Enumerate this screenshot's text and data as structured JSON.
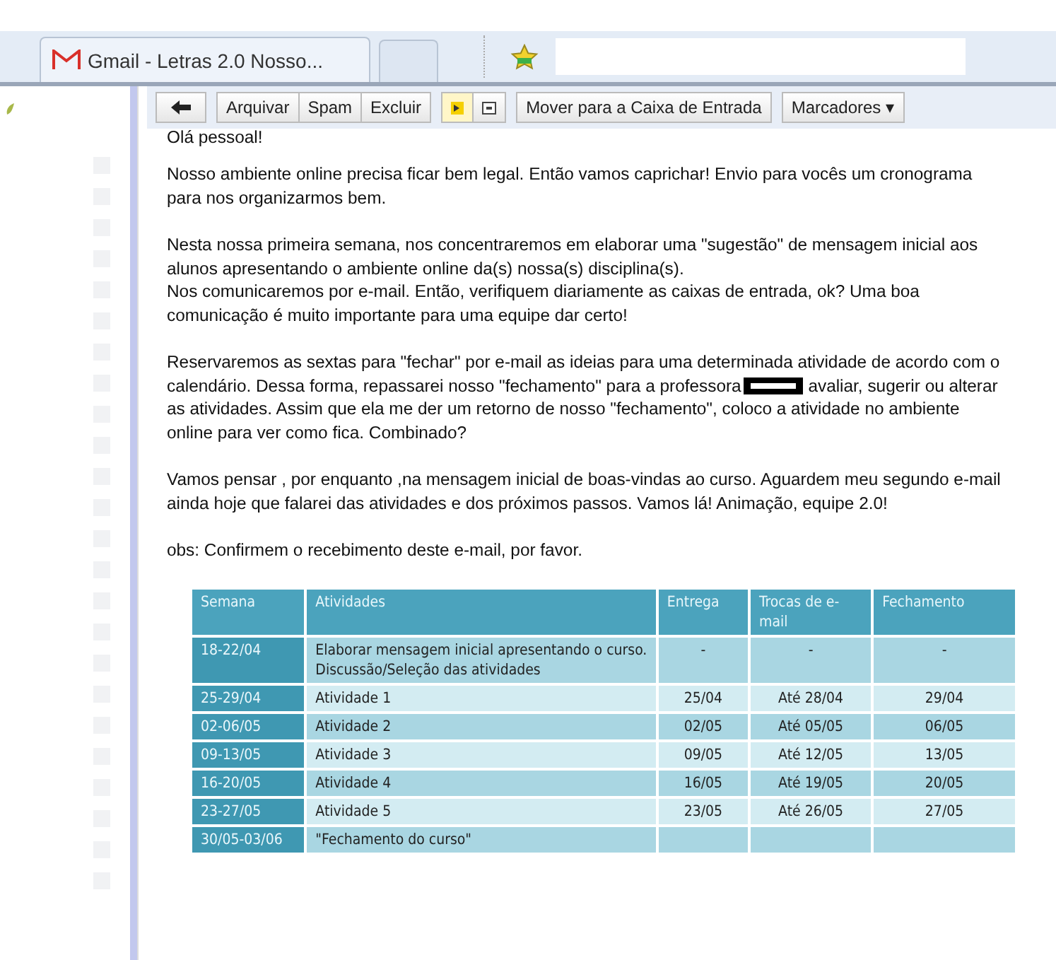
{
  "browser": {
    "tabs": [
      {
        "kind": "page",
        "title": "Gmail - Letras 2.0 Nosso...",
        "selected": true
      },
      {
        "kind": "new",
        "selected": false
      }
    ]
  },
  "toolbar": {
    "groups": [
      [
        {
          "kind": "back"
        }
      ],
      [
        {
          "kind": "text",
          "label": "Arquivar"
        },
        {
          "kind": "text",
          "label": "Spam"
        },
        {
          "kind": "text",
          "label": "Excluir"
        }
      ],
      [
        {
          "kind": "important"
        },
        {
          "kind": "square"
        }
      ],
      [
        {
          "kind": "text",
          "label": "Mover para a Caixa de Entrada"
        }
      ],
      [
        {
          "kind": "menu",
          "label": "Marcadores",
          "caret": "▾"
        }
      ]
    ]
  },
  "message": {
    "greeting": "Olá pessoal!",
    "paragraphs": [
      [
        {
          "kind": "text",
          "text": "Nosso ambiente online precisa ficar bem legal. Então vamos caprichar! Envio para vocês um cronograma para nos organizarmos bem."
        }
      ],
      [
        {
          "kind": "text",
          "text": "Nesta nossa primeira semana, nos concentraremos em elaborar uma \"sugestão\" de mensagem inicial aos alunos apresentando o ambiente online da(s) nossa(s) disciplina(s)."
        },
        {
          "kind": "break"
        },
        {
          "kind": "text",
          "text": "Nos comunicaremos por e-mail. Então, verifiquem diariamente as caixas de entrada, ok? Uma boa comunicação é muito importante para uma equipe dar certo!"
        }
      ],
      [
        {
          "kind": "text",
          "text": "Reservaremos as sextas para \"fechar\" por e-mail as ideias para uma determinada atividade de acordo com o calendário. Dessa forma, repassarei nosso \"fechamento\" para a professora"
        },
        {
          "kind": "redaction"
        },
        {
          "kind": "text",
          "text": " avaliar, sugerir ou  alterar as atividades. Assim que ela me der um retorno de nosso \"fechamento\", coloco a atividade no ambiente online para ver como fica. Combinado?"
        }
      ],
      [
        {
          "kind": "text",
          "text": "Vamos pensar , por enquanto ,na mensagem inicial de boas-vindas ao curso. Aguardem meu segundo e-mail ainda hoje que falarei das atividades e dos próximos passos. Vamos lá! Animação, equipe 2.0!"
        }
      ],
      [
        {
          "kind": "text",
          "text": "obs: Confirmem o recebimento deste e-mail, por favor."
        }
      ]
    ]
  },
  "table": {
    "columns": [
      "Semana",
      "Atividades",
      "Entrega",
      "Trocas de e-mail",
      "Fechamento"
    ],
    "rows": [
      [
        "18-22/04",
        "Elaborar mensagem inicial apresentando o curso.\nDiscussão/Seleção das atividades",
        "-",
        "-",
        "-"
      ],
      [
        "25-29/04",
        "Atividade 1",
        "25/04",
        "Até 28/04",
        "29/04"
      ],
      [
        "02-06/05",
        "Atividade 2",
        "02/05",
        "Até 05/05",
        "06/05"
      ],
      [
        "09-13/05",
        "Atividade 3",
        "09/05",
        "Até 12/05",
        "13/05"
      ],
      [
        "16-20/05",
        "Atividade 4",
        "16/05",
        "Até 19/05",
        "20/05"
      ],
      [
        "23-27/05",
        "Atividade 5",
        "23/05",
        "Até 26/05",
        "27/05"
      ],
      [
        "30/05-03/06",
        "\"Fechamento do curso\"",
        "",
        "",
        ""
      ]
    ]
  }
}
